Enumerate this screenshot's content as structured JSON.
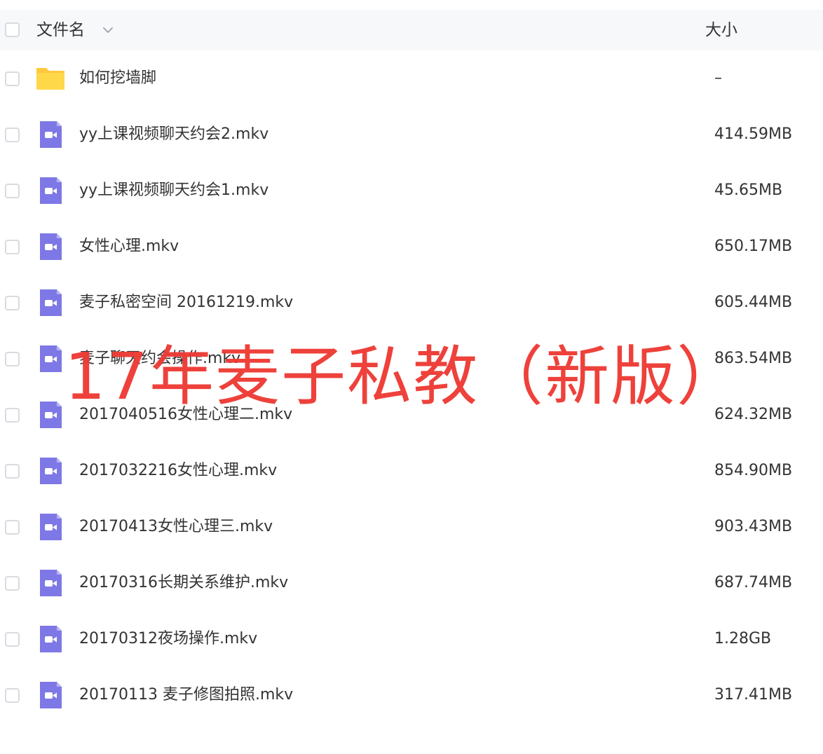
{
  "colors": {
    "header_bg": "#f7f8fa",
    "text": "#333333",
    "folder": "#ffcc33",
    "video_icon": "#7d78e6",
    "watermark": "#ee3a34"
  },
  "header": {
    "name_label": "文件名",
    "sort_icon": "chevron-down-icon",
    "size_label": "大小"
  },
  "files": [
    {
      "name": "如何挖墙脚",
      "size": "–",
      "type": "folder"
    },
    {
      "name": "yy上课视频聊天约会2.mkv",
      "size": "414.59MB",
      "type": "video"
    },
    {
      "name": "yy上课视频聊天约会1.mkv",
      "size": "45.65MB",
      "type": "video"
    },
    {
      "name": "女性心理.mkv",
      "size": "650.17MB",
      "type": "video"
    },
    {
      "name": "麦子私密空间 20161219.mkv",
      "size": "605.44MB",
      "type": "video"
    },
    {
      "name": "麦子聊天约会操作.mkv",
      "size": "863.54MB",
      "type": "video"
    },
    {
      "name": "2017040516女性心理二.mkv",
      "size": "624.32MB",
      "type": "video"
    },
    {
      "name": "2017032216女性心理.mkv",
      "size": "854.90MB",
      "type": "video"
    },
    {
      "name": "20170413女性心理三.mkv",
      "size": "903.43MB",
      "type": "video"
    },
    {
      "name": "20170316长期关系维护.mkv",
      "size": "687.74MB",
      "type": "video"
    },
    {
      "name": "20170312夜场操作.mkv",
      "size": "1.28GB",
      "type": "video"
    },
    {
      "name": "20170113 麦子修图拍照.mkv",
      "size": "317.41MB",
      "type": "video"
    }
  ],
  "watermark": {
    "text": "17年麦子私教（新版）"
  }
}
